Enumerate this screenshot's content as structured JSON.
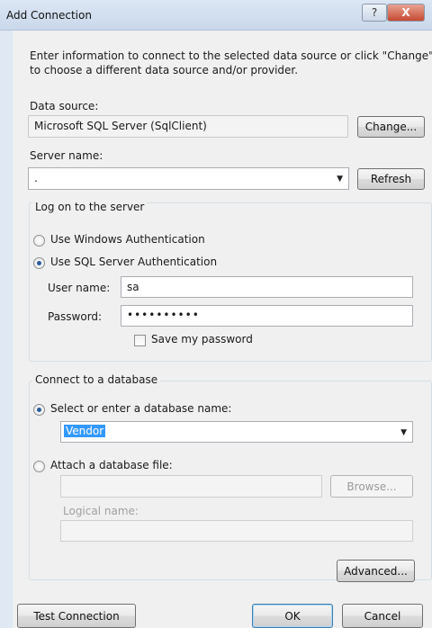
{
  "window": {
    "title": "Add Connection",
    "help_glyph": "?",
    "close_glyph": "X"
  },
  "intro_text": "Enter information to connect to the selected data source or click \"Change\" to choose a different data source and/or provider.",
  "data_source": {
    "label": "Data source:",
    "value": "Microsoft SQL Server (SqlClient)",
    "change_button": "Change..."
  },
  "server": {
    "label": "Server name:",
    "value": ".",
    "refresh_button": "Refresh"
  },
  "logon": {
    "group_title": "Log on to the server",
    "windows_auth": "Use Windows Authentication",
    "sql_auth": "Use SQL Server Authentication",
    "selected": "sql",
    "username_label": "User name:",
    "username_value": "sa",
    "password_label": "Password:",
    "password_value": "••••••••••",
    "save_password_label": "Save my password",
    "save_password_checked": false
  },
  "database": {
    "group_title": "Connect to a database",
    "select_option": "Select or enter a database name:",
    "db_name_value": "Vendor",
    "attach_option": "Attach a database file:",
    "browse_button": "Browse...",
    "logical_name_label": "Logical name:"
  },
  "buttons": {
    "advanced": "Advanced...",
    "test_connection": "Test Connection",
    "ok": "OK",
    "cancel": "Cancel"
  },
  "colors": {
    "selection": "#3399ff",
    "close_button": "#c64a33",
    "radio_dot": "#2a5b9c"
  }
}
